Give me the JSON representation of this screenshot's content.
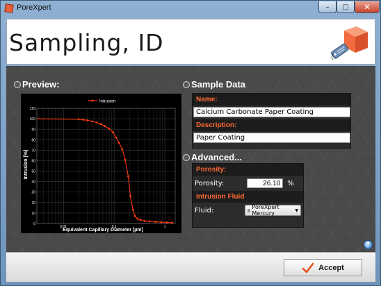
{
  "window": {
    "title": "PoreXpert",
    "close_glyph": "✕",
    "minimize_glyph": "–",
    "maximize_glyph": "□"
  },
  "header": {
    "page_title": "Sampling, ID",
    "logo_icon": "porexpert-cube-tag-icon"
  },
  "preview": {
    "heading": "Preview:",
    "chart_data": {
      "type": "line",
      "title": "",
      "legend": "Intrusion",
      "legend_position": "top-center",
      "xlabel": "Equivalent Capillary Diameter [µm]",
      "ylabel": "Intrusion [%]",
      "xscale": "log",
      "xlim": [
        0.003,
        1.6
      ],
      "ylim": [
        0,
        110
      ],
      "x_ticks": [
        "0.01",
        "0.1",
        "1"
      ],
      "y_ticks": [
        "0",
        "10",
        "20",
        "30",
        "40",
        "50",
        "60",
        "70",
        "80",
        "90",
        "100",
        "110"
      ],
      "grid": true,
      "series": [
        {
          "name": "Intrusion",
          "color": "#ff3b10",
          "x": [
            0.02,
            0.025,
            0.03,
            0.037,
            0.045,
            0.055,
            0.065,
            0.08,
            0.095,
            0.11,
            0.125,
            0.145,
            0.165,
            0.19,
            0.21,
            0.235,
            0.26,
            0.29,
            0.33,
            0.4,
            0.5,
            0.65,
            0.85,
            1.1,
            1.4
          ],
          "y": [
            99.5,
            99,
            98.5,
            97.5,
            96.5,
            95,
            93,
            90.5,
            87,
            82,
            77,
            71,
            61,
            45,
            26,
            13,
            7,
            4.5,
            3.5,
            2.5,
            2,
            1.6,
            1.3,
            1.0,
            0.8
          ],
          "line_start": {
            "x": 0.003,
            "y": 100
          }
        }
      ]
    }
  },
  "sample_data": {
    "heading": "Sample Data",
    "name_label": "Name:",
    "name_value": "Calcium Carbonate Paper Coating",
    "description_label": "Description:",
    "description_value": "Paper Coating"
  },
  "advanced": {
    "heading": "Advanced...",
    "porosity_section": "Porosity:",
    "porosity_label": "Porosity:",
    "porosity_value": "26.10",
    "porosity_unit": "%",
    "intrusion_section": "Intrusion Fluid",
    "fluid_label": "Fluid:",
    "fluid_value": "PoreXpert Mercury"
  },
  "help": {
    "glyph": "?"
  },
  "footer": {
    "accept_label": "Accept"
  }
}
